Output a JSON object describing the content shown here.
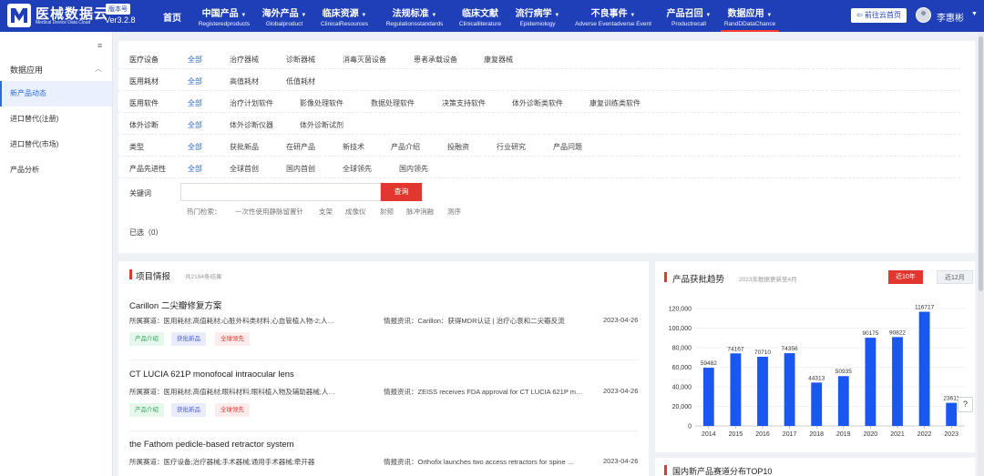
{
  "brand": {
    "name_cn": "医械数据云",
    "name_en": "Medical Device Data Cloud",
    "version_badge": "版本号",
    "version": "Ver3.2.8",
    "primary_color": "#1f3fb8"
  },
  "nav": [
    {
      "cn": "首页",
      "en": "",
      "caret": false
    },
    {
      "cn": "中国产品",
      "en": "Registeredproducts",
      "caret": true
    },
    {
      "cn": "海外产品",
      "en": "Globalproduct",
      "caret": true
    },
    {
      "cn": "临床资源",
      "en": "ClinicalResources",
      "caret": true
    },
    {
      "cn": "法规标准",
      "en": "Regulationsstandards",
      "caret": true
    },
    {
      "cn": "临床文献",
      "en": "Clinicalliterature",
      "caret": false
    },
    {
      "cn": "流行病学",
      "en": "Epidemiology",
      "caret": true
    },
    {
      "cn": "不良事件",
      "en": "Adverse Eventadverse Event",
      "caret": true
    },
    {
      "cn": "产品召回",
      "en": "Productrecall",
      "caret": true
    },
    {
      "cn": "数据应用",
      "en": "RandDDataChance",
      "caret": true
    }
  ],
  "header": {
    "cloud_button": "前往云首页",
    "username": "李惠彬"
  },
  "sidebar": {
    "group": "数据应用",
    "items": [
      "新产品动态",
      "进口替代(注册)",
      "进口替代(市场)",
      "产品分析"
    ]
  },
  "filters": [
    {
      "label": "医疗设备",
      "options": [
        "全部",
        "治疗器械",
        "诊断器械",
        "消毒灭菌设备",
        "患者承载设备",
        "康复器械"
      ]
    },
    {
      "label": "医用耗材",
      "options": [
        "全部",
        "高值耗材",
        "低值耗材"
      ]
    },
    {
      "label": "医用软件",
      "options": [
        "全部",
        "治疗计划软件",
        "影像处理软件",
        "数据处理软件",
        "决策支持软件",
        "体外诊断类软件",
        "康复训练类软件"
      ]
    },
    {
      "label": "体外诊断",
      "options": [
        "全部",
        "体外诊断仪器",
        "体外诊断试剂"
      ]
    },
    {
      "label": "类型",
      "options": [
        "全部",
        "获批新品",
        "在研产品",
        "新技术",
        "产品介绍",
        "投融资",
        "行业研究",
        "产品问题"
      ]
    },
    {
      "label": "产品先进性",
      "options": [
        "全部",
        "全球首创",
        "国内首创",
        "全球领先",
        "国内领先"
      ]
    }
  ],
  "keyword": {
    "label": "关键词",
    "value": "",
    "button": "查询",
    "hot_label": "热门检索：",
    "hot_terms": [
      "一次性使用静脉留置针",
      "支架",
      "成像仪",
      "射频",
      "脉冲消融",
      "测序"
    ]
  },
  "selected_label": "已选（0）",
  "projects": {
    "title": "项目情报",
    "count": "共2184条结果",
    "items": [
      {
        "title": "Carillon 二尖瓣修复方案",
        "track": "所属赛道：医用耗材;高值耗材;心脏外科类材料;心血管植入物-2;人…",
        "news": "情报资讯：Carillon：获得MDR认证 | 治疗心衰和二尖瓣反流",
        "date": "2023-04-26",
        "tags": [
          "产品介绍",
          "获批新品",
          "全球领先"
        ]
      },
      {
        "title": "CT LUCIA 621P monofocal intraocular lens",
        "track": "所属赛道：医用耗材;高值耗材;眼科材料;眼科植入物及辅助器械;人…",
        "news": "情报资讯：ZEISS receives FDA approval for CT LUCIA 621P m…",
        "date": "2023-04-26",
        "tags": [
          "产品介绍",
          "获批新品",
          "全球领先"
        ]
      },
      {
        "title": "the Fathom pedicle-based retractor system",
        "track": "所属赛道：医疗设备;治疗器械;手术器械;通用手术器械;牵开器",
        "news": "情报资讯：Orthofix launches two access retractors for spine …",
        "date": "2023-04-26",
        "tags": []
      }
    ]
  },
  "chart_panel": {
    "title": "产品获批趋势",
    "subtitle": "2023年数据更新至4月",
    "range_on": "近10年",
    "range_off": "近12月",
    "bar_color": "#1a56f0",
    "accent": "#e1372f"
  },
  "chart_data": {
    "type": "bar",
    "categories": [
      "2014",
      "2015",
      "2016",
      "2017",
      "2018",
      "2019",
      "2020",
      "2021",
      "2022",
      "2023"
    ],
    "values": [
      59482,
      74167,
      70710,
      74356,
      44313,
      50935,
      90175,
      90822,
      116717,
      23611
    ],
    "data_labels": [
      "59482",
      "74167",
      "70710",
      "74356",
      "44313",
      "50935",
      "90175",
      "90822",
      "116717",
      "23611"
    ],
    "y_ticks": [
      "0",
      "20,000",
      "40,000",
      "60,000",
      "80,000",
      "100,000",
      "120,000"
    ],
    "ylim": [
      0,
      120000
    ],
    "grid": true,
    "legend": "none"
  },
  "top10": {
    "title": "国内新产品赛道分布TOP10"
  },
  "help_label": "?"
}
